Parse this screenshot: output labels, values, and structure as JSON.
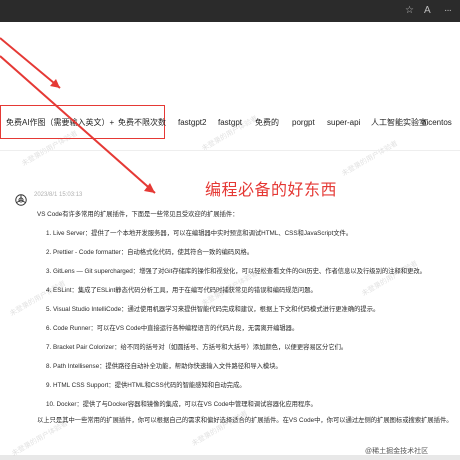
{
  "browser": {
    "icons": [
      "star-icon",
      "font-size-icon",
      "more-icon"
    ],
    "star_glyph": "☆",
    "font_glyph": "A",
    "more_glyph": "···"
  },
  "tabs": [
    {
      "label": "免费AI作图（需要输入英文）+"
    },
    {
      "label": "免费不限次数"
    },
    {
      "label": "fastgpt2"
    },
    {
      "label": "fastgpt"
    },
    {
      "label": "免费的"
    },
    {
      "label": "porgpt"
    },
    {
      "label": "super-api"
    },
    {
      "label": "人工智能实验室"
    },
    {
      "label": "aicentos"
    }
  ],
  "annotation": {
    "text": "编程必备的好东西",
    "color": "#e53935"
  },
  "message": {
    "timestamp": "2023/8/1 15:03:13",
    "intro": "VS Code有许多常用的扩展插件，下面是一些常见且受欢迎的扩展插件：",
    "items": [
      "1. Live Server：提供了一个本地开发服务器，可以在编辑器中实时预览和调试HTML、CSS和JavaScript文件。",
      "2. Prettier - Code formatter：自动格式化代码，使其符合一致的编码风格。",
      "3. GitLens — Git supercharged：增强了对Git存储库的操作和视觉化，可以轻松查看文件的Git历史、作者信息以及行级别的注释和更改。",
      "4. ESLint：集成了ESLint静态代码分析工具，用于在编写代码时捕获常见的错误和编码规范问题。",
      "5. Visual Studio IntelliCode：通过使用机器学习来提供智能代码完成和建议，根据上下文和代码模式进行更准确的提示。",
      "6. Code Runner：可以在VS Code中直接运行各种编程语言的代码片段，无需离开编辑器。",
      "7. Bracket Pair Colorizer：给不同的括号对（如圆括号、方括号和大括号）添加颜色，以便更容易区分它们。",
      "8. Path Intellisense：提供路径自动补全功能，帮助你快速输入文件路径和导入模块。",
      "9. HTML CSS Support：提供HTML和CSS代码的智能感知和自动完成。",
      "10. Docker：提供了与Docker容器和镜像的集成，可以在VS Code中管理和调试容器化应用程序。"
    ],
    "outro": "以上只是其中一些常用的扩展插件，你可以根据自己的需求和偏好选择适合的扩展插件。在VS Code中，你可以通过左侧的扩展图标或搜索扩展插件。"
  },
  "watermark_text": "未登录的用户体验者",
  "footer_badge": "@稀土掘金技术社区",
  "colors": {
    "accent_red": "#e53935",
    "page_bg": "#ffffff",
    "chrome_bg": "#2b2b2b"
  }
}
